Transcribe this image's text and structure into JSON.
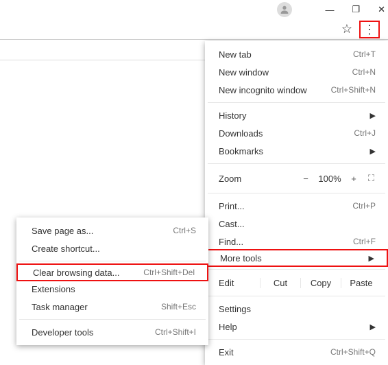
{
  "window": {
    "min": "—",
    "max": "❐",
    "close": "✕"
  },
  "addr": {
    "star": "☆",
    "menu": "⋮"
  },
  "menu": {
    "newTab": "New tab",
    "newWindow": "New window",
    "newIncognito": "New incognito window",
    "history": "History",
    "downloads": "Downloads",
    "bookmarks": "Bookmarks",
    "zoom": "Zoom",
    "print": "Print...",
    "cast": "Cast...",
    "find": "Find...",
    "moreTools": "More tools",
    "edit": "Edit",
    "cut": "Cut",
    "copy": "Copy",
    "paste": "Paste",
    "settings": "Settings",
    "help": "Help",
    "exit": "Exit",
    "zoomVal": "100%"
  },
  "hints": {
    "newTab": "Ctrl+T",
    "newWindow": "Ctrl+N",
    "newIncognito": "Ctrl+Shift+N",
    "downloads": "Ctrl+J",
    "print": "Ctrl+P",
    "find": "Ctrl+F",
    "exit": "Ctrl+Shift+Q"
  },
  "sub": {
    "saveAs": "Save page as...",
    "createShortcut": "Create shortcut...",
    "clearData": "Clear browsing data...",
    "extensions": "Extensions",
    "taskManager": "Task manager",
    "devTools": "Developer tools"
  },
  "shints": {
    "saveAs": "Ctrl+S",
    "clearData": "Ctrl+Shift+Del",
    "taskManager": "Shift+Esc",
    "devTools": "Ctrl+Shift+I"
  },
  "glyph": {
    "arrow": "▶",
    "minus": "−",
    "plus": "+",
    "full": "⛶"
  }
}
